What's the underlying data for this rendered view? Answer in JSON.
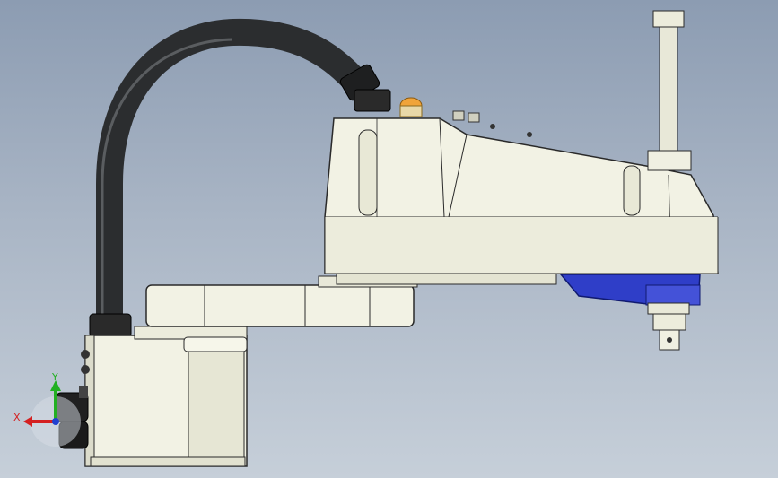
{
  "viewport": {
    "background_top": "#8c9cb2",
    "background_bottom": "#c6cfd9"
  },
  "model": {
    "body_color": "#f2f2e4",
    "shadow_color": "#d8d8c6",
    "edge_color": "#2a2a2a",
    "cable_color": "#2b2d2f",
    "accent_color": "#2f3ec8",
    "lamp_color": "#f0a43a"
  },
  "triad": {
    "x_label": "X",
    "y_label": "Y",
    "x_color": "#d42020",
    "y_color": "#22b022",
    "z_color": "#2040d0"
  }
}
